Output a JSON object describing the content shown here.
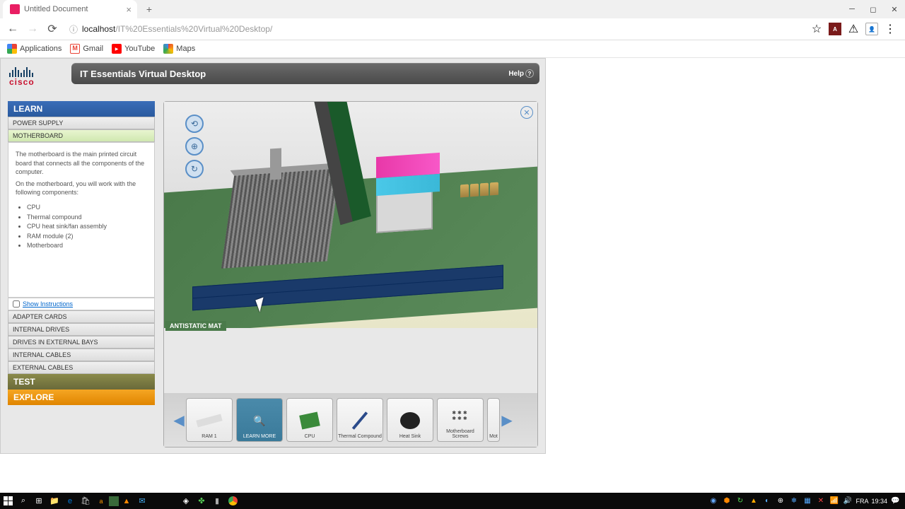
{
  "browser": {
    "tab_title": "Untitled Document",
    "url_host": "localhost",
    "url_path": "/IT%20Essentials%20Virtual%20Desktop/",
    "bookmarks": [
      {
        "label": "Applications",
        "color": "#d84315"
      },
      {
        "label": "Gmail",
        "color": "#ea4335"
      },
      {
        "label": "YouTube",
        "color": "#ff0000"
      },
      {
        "label": "Maps",
        "color": "#34a853"
      }
    ]
  },
  "app": {
    "title": "IT Essentials Virtual Desktop",
    "help": "Help",
    "logo": "cisco",
    "sections": {
      "learn": "LEARN",
      "test": "TEST",
      "explore": "EXPLORE"
    },
    "nav": {
      "power_supply": "POWER SUPPLY",
      "motherboard": "MOTHERBOARD",
      "adapter_cards": "ADAPTER CARDS",
      "internal_drives": "INTERNAL DRIVES",
      "external_bays": "DRIVES IN EXTERNAL BAYS",
      "internal_cables": "INTERNAL CABLES",
      "external_cables": "EXTERNAL CABLES"
    },
    "info": {
      "p1": "The motherboard is the main printed circuit board that connects all the components of the computer.",
      "p2": "On the motherboard, you will work with the following components:",
      "items": [
        "CPU",
        "Thermal compound",
        "CPU heat sink/fan assembly",
        "RAM module (2)",
        "Motherboard"
      ],
      "show_instructions": "Show Instructions"
    },
    "mat_label": "ANTISTATIC MAT",
    "tray": {
      "ram1": "RAM 1",
      "learn_more": "LEARN MORE",
      "cpu": "CPU",
      "thermal": "Thermal Compound",
      "heatsink": "Heat Sink",
      "screws": "Motherboard Screws",
      "mobo": "Mot"
    }
  },
  "taskbar": {
    "lang": "FRA",
    "time": "19:34"
  }
}
